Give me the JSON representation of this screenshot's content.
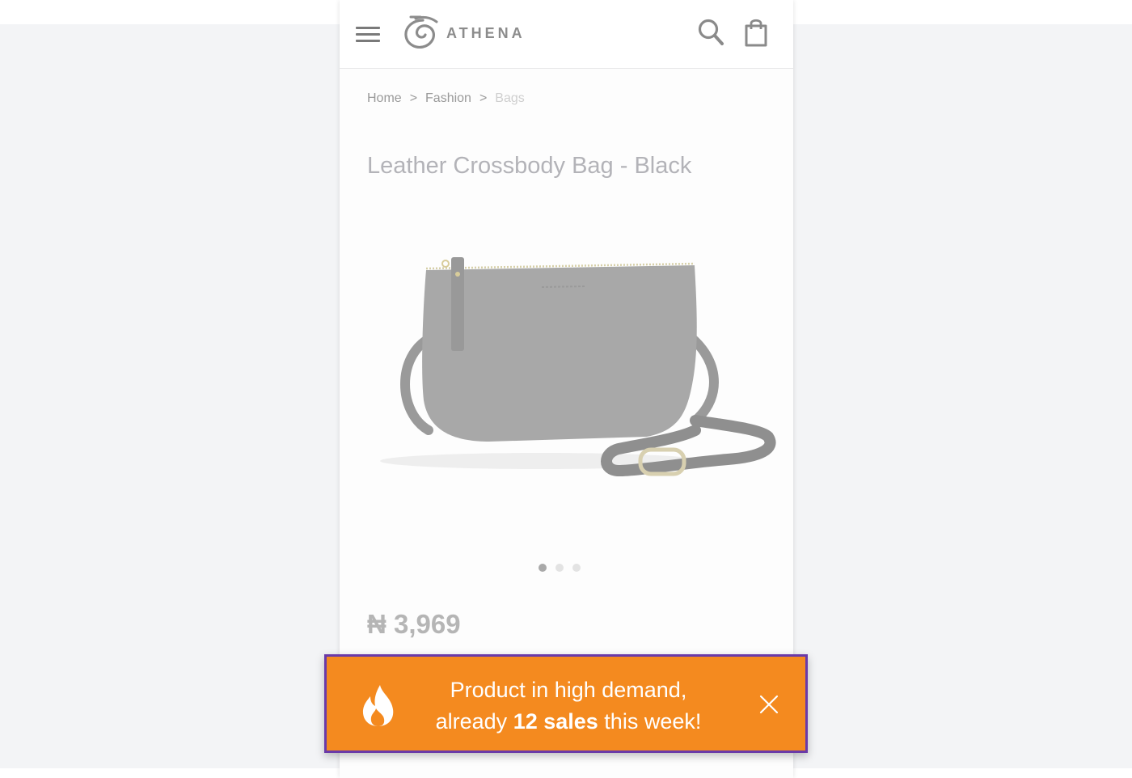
{
  "header": {
    "logo_text": "ATHENA",
    "menu_icon": "hamburger-menu-icon",
    "search_icon": "search-icon",
    "cart_icon": "shopping-bag-icon"
  },
  "breadcrumb": {
    "items": [
      "Home",
      "Fashion",
      "Bags"
    ],
    "separator": ">"
  },
  "product": {
    "title": "Leather Crossbody Bag - Black",
    "price": "₦ 3,969",
    "image_count": 3,
    "active_image": 1
  },
  "notice": {
    "line1": "Product in high demand,",
    "line2_prefix": "already ",
    "line2_bold": "12 sales",
    "line2_suffix": " this week!",
    "icon": "flame-icon",
    "close_icon": "close-icon"
  },
  "colors": {
    "notice_background": "#f48a1f",
    "notice_border": "#6a3aa8",
    "page_background": "#f3f4f6"
  }
}
